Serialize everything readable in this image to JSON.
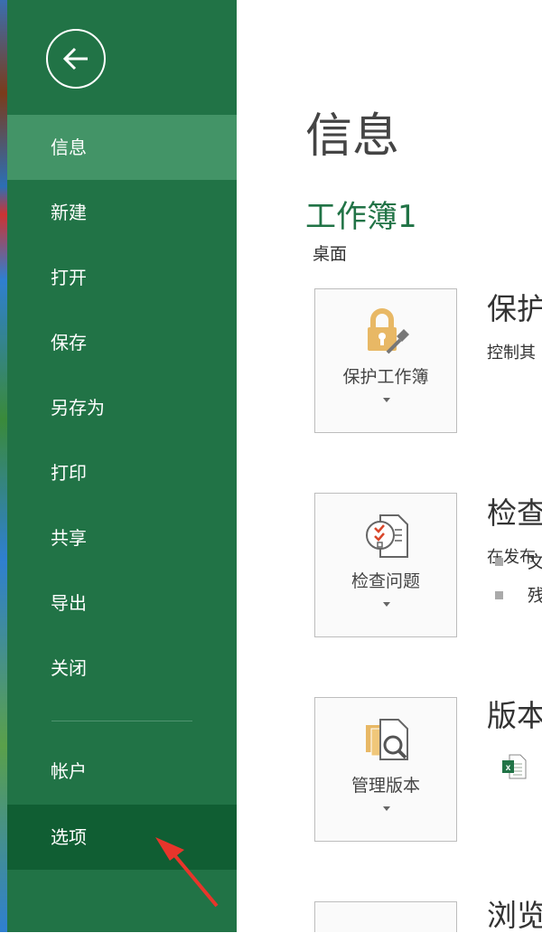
{
  "sidebar": {
    "items": [
      {
        "label": "信息"
      },
      {
        "label": "新建"
      },
      {
        "label": "打开"
      },
      {
        "label": "保存"
      },
      {
        "label": "另存为"
      },
      {
        "label": "打印"
      },
      {
        "label": "共享"
      },
      {
        "label": "导出"
      },
      {
        "label": "关闭"
      },
      {
        "label": "帐户"
      },
      {
        "label": "选项"
      }
    ]
  },
  "main": {
    "title": "信息",
    "workbook": "工作簿1",
    "location": "桌面",
    "sections": [
      {
        "button": "保护工作簿",
        "heading": "保护",
        "desc": "控制其"
      },
      {
        "button": "检查问题",
        "heading": "检查",
        "desc": "在发布",
        "bullets": [
          "文",
          "残"
        ]
      },
      {
        "button": "管理版本",
        "heading": "版本"
      },
      {
        "heading": "浏览"
      }
    ]
  },
  "colors": {
    "sidebar": "#217346",
    "selected": "#439467",
    "options": "#105e33",
    "accent": "#217346"
  }
}
